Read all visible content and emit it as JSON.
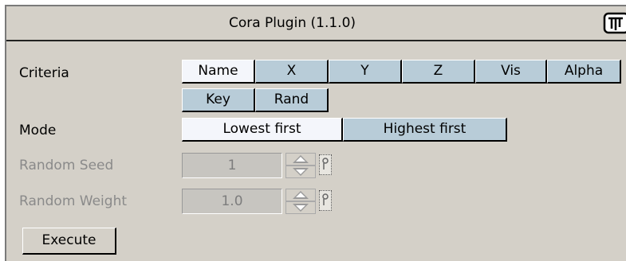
{
  "title": "Cora Plugin (1.1.0)",
  "icon": "plugin-icon",
  "criteria": {
    "label": "Criteria",
    "options": [
      "Name",
      "X",
      "Y",
      "Z",
      "Vis",
      "Alpha",
      "Key",
      "Rand"
    ],
    "selected": "Name"
  },
  "mode": {
    "label": "Mode",
    "options": [
      "Lowest first",
      "Highest first"
    ],
    "selected": "Lowest first"
  },
  "random_seed": {
    "label": "Random Seed",
    "value": "1"
  },
  "random_weight": {
    "label": "Random Weight",
    "value": "1.0"
  },
  "execute_label": "Execute"
}
